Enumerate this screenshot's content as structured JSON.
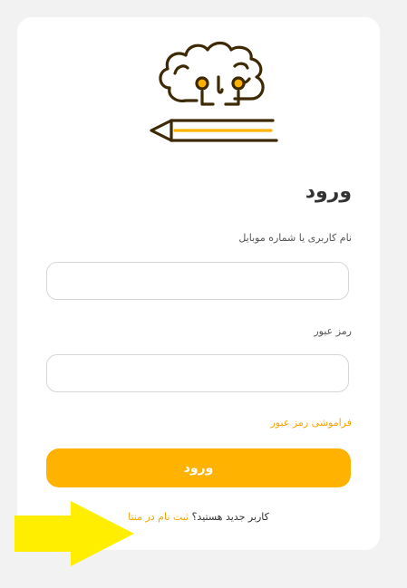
{
  "login": {
    "title": "ورود",
    "username_label": "نام کاربری یا شماره موبایل",
    "username_value": "",
    "password_label": "رمز عبور",
    "password_value": "",
    "forgot_link": "فراموشی رمز عبور",
    "submit_label": "ورود",
    "new_user_question": "کاربر جدید هستید؟",
    "register_link": "ثبت نام در منتا"
  },
  "colors": {
    "accent": "#ffb300",
    "link": "#f5a300",
    "logo_stroke": "#3d2a05",
    "annotation_arrow": "#ffee00",
    "background": "#f2f2f2",
    "card": "#ffffff"
  },
  "icons": {
    "logo": "brain-pencil-logo",
    "annotation": "yellow-arrow"
  }
}
